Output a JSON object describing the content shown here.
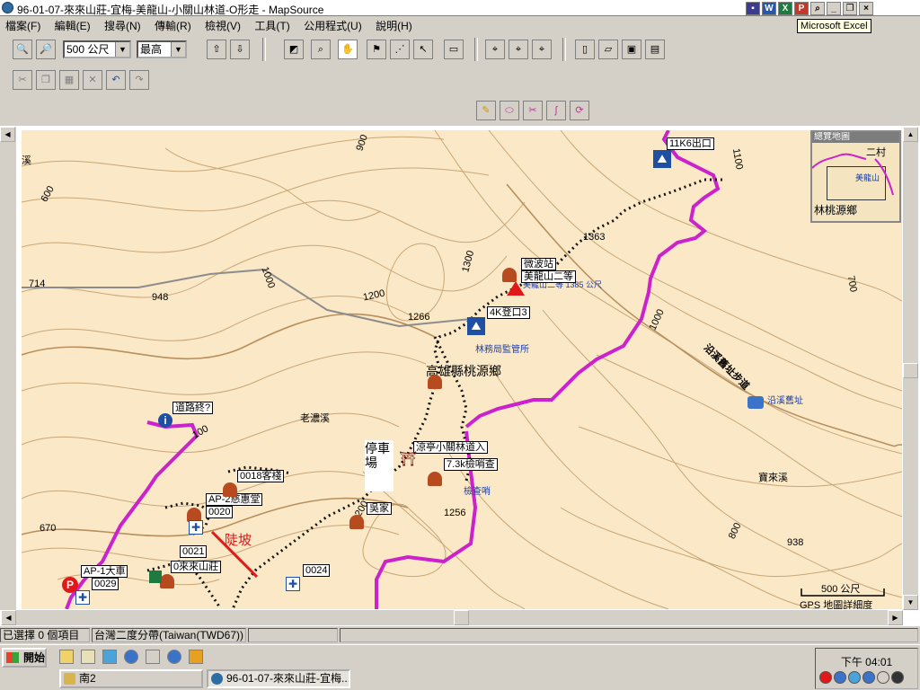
{
  "window": {
    "title": "96-01-07-來來山莊-宜梅-美龍山-小關山林道-O形走 - MapSource"
  },
  "tooltip": {
    "text": "Microsoft Excel"
  },
  "menu": [
    "檔案(F)",
    "編輯(E)",
    "搜尋(N)",
    "傳輸(R)",
    "檢視(V)",
    "工具(T)",
    "公用程式(U)",
    "說明(H)"
  ],
  "toolbar": {
    "scale_value": "500 公尺",
    "detail_value": "最高"
  },
  "map": {
    "labels": {
      "peak_1363": "1363",
      "peak_1266": "1266",
      "peak_948": "948",
      "peak_714": "714",
      "peak_670": "670",
      "peak_1256": "1256",
      "peak_938": "938",
      "contour_900": "900",
      "contour_600": "600",
      "contour_1000a": "1000",
      "contour_1200a": "1200",
      "contour_1300": "1300",
      "contour_1000b": "1000",
      "contour_1100": "1100",
      "contour_700": "700",
      "contour_800": "800",
      "contour_1200b": "1200",
      "contour_100": "100",
      "river_north": "溪",
      "stream_laonong": "老濃溪",
      "stream_baolai": "寶來溪",
      "road_name": "沿溪舊址步道",
      "township": "高雄縣桃源鄉",
      "parking": "停車場",
      "slope": "陡坡",
      "forestry_station": "林務局監管所",
      "checkpoint": "檢查哨",
      "old_site": "沿溪舊址",
      "scale_text": "500 公尺",
      "scale_note": "GPS 地圖詳細度",
      "peak_detail": "美龍山二等 1385 公尺"
    },
    "waypoints": {
      "w_11k6": "11K6出口",
      "w_weibo": "微波站",
      "w_meilong": "美龍山二等",
      "w_4k": "4K登口3",
      "w_guide": "道路終?",
      "w_liangting": "涼亭小關林道入",
      "w_73k": "7.3k檢哨查",
      "w_0018": "0018客棧",
      "w_ap2": "AP-2慈惠堂",
      "w_0020": "0020",
      "w_0021": "0021",
      "w_lailai": "0來來山莊",
      "w_ap1": "AP-1大車",
      "w_0029": "0029",
      "w_0024": "0024",
      "w_wujia": "吳家"
    }
  },
  "minimap": {
    "title": "總覽地圖",
    "label1": "二村",
    "label2": "美龍山",
    "label3": "林桃源鄉"
  },
  "status": {
    "selection": "已選擇 0 個項目",
    "datum": "台灣二度分帶(Taiwan(TWD67))"
  },
  "taskbar": {
    "start": "開始",
    "task1": "南2",
    "task2": "96-01-07-來來山莊-宜梅...",
    "clock": "下午 04:01"
  }
}
